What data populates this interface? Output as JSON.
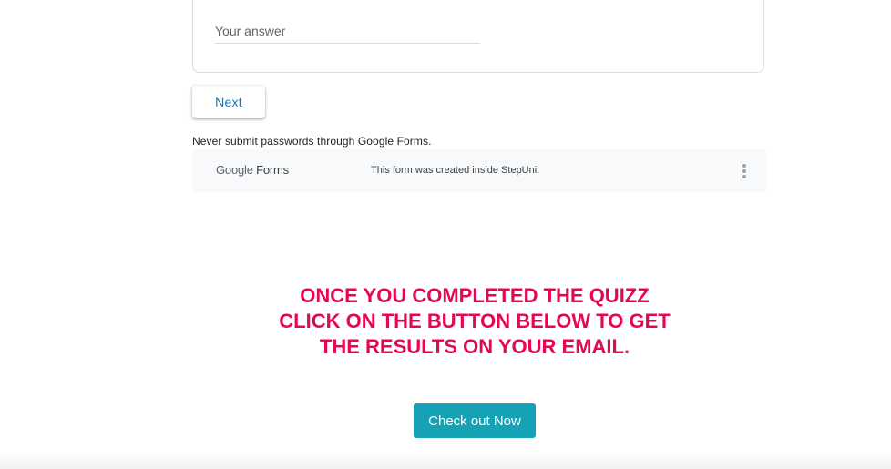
{
  "form": {
    "answer_placeholder": "Your answer",
    "next_label": "Next",
    "warning": "Never submit passwords through Google Forms.",
    "footer": {
      "logo_google": "Google",
      "logo_forms": "Forms",
      "note": "This form was created inside StepUni.",
      "more_icon": "more-vert-icon"
    }
  },
  "cta": {
    "line1": "ONCE YOU COMPLETED THE QUIZZ",
    "line2": "CLICK ON THE BUTTON BELOW TO GET",
    "line3": "THE RESULTS ON YOUR EMAIL.",
    "button_label": "Check out Now"
  },
  "colors": {
    "accent_link": "#1a73a8",
    "cta_text": "#e4094f",
    "cta_button": "#15a2b4",
    "footer_bg": "#f8f9fa"
  }
}
